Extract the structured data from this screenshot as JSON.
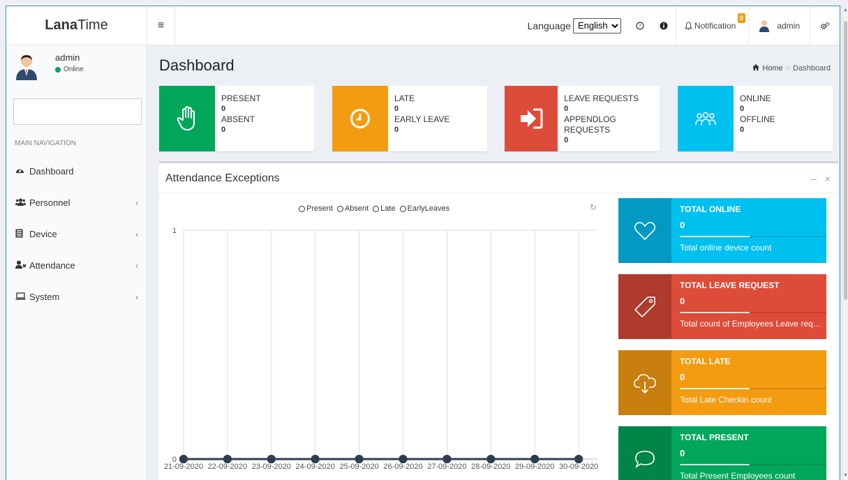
{
  "brand": {
    "bold": "Lana",
    "light": "Time"
  },
  "topbar": {
    "language_label": "Language",
    "language_value": "English",
    "notification_label": "Notification",
    "notification_count": "0",
    "user_name": "admin"
  },
  "sidebar": {
    "user_name": "admin",
    "user_status": "Online",
    "nav_header": "MAIN NAVIGATION",
    "items": [
      {
        "label": "Dashboard",
        "icon": "dashboard-icon"
      },
      {
        "label": "Personnel",
        "icon": "users-icon"
      },
      {
        "label": "Device",
        "icon": "device-icon"
      },
      {
        "label": "Attendance",
        "icon": "attendance-icon"
      },
      {
        "label": "System",
        "icon": "laptop-icon"
      }
    ]
  },
  "page": {
    "title": "Dashboard",
    "breadcrumb": {
      "home": "Home",
      "current": "Dashboard"
    }
  },
  "info_boxes": [
    {
      "color": "#00a65a",
      "icon": "hand-icon",
      "l1": "PRESENT",
      "v1": "0",
      "l2": "ABSENT",
      "v2": "0"
    },
    {
      "color": "#f39c12",
      "icon": "clock-icon",
      "l1": "LATE",
      "v1": "0",
      "l2": "EARLY LEAVE",
      "v2": "0"
    },
    {
      "color": "#dd4b39",
      "icon": "sign-in-icon",
      "l1": "LEAVE REQUESTS",
      "v1": "0",
      "l2": "APPENDLOG REQUESTS",
      "v2": "0"
    },
    {
      "color": "#00c0ef",
      "icon": "group-icon",
      "l1": "ONLINE",
      "v1": "0",
      "l2": "OFFLINE",
      "v2": "0"
    }
  ],
  "panel": {
    "title": "Attendance Exceptions"
  },
  "chart_data": {
    "type": "line",
    "x": [
      "21-09-2020",
      "22-09-2020",
      "23-09-2020",
      "24-09-2020",
      "25-09-2020",
      "26-09-2020",
      "27-09-2020",
      "28-09-2020",
      "29-09-2020",
      "30-09-2020"
    ],
    "series": [
      {
        "name": "Present",
        "values": [
          0,
          0,
          0,
          0,
          0,
          0,
          0,
          0,
          0,
          0
        ]
      },
      {
        "name": "Absent",
        "values": [
          0,
          0,
          0,
          0,
          0,
          0,
          0,
          0,
          0,
          0
        ]
      },
      {
        "name": "Late",
        "values": [
          0,
          0,
          0,
          0,
          0,
          0,
          0,
          0,
          0,
          0
        ]
      },
      {
        "name": "EarlyLeaves",
        "values": [
          0,
          0,
          0,
          0,
          0,
          0,
          0,
          0,
          0,
          0
        ]
      }
    ],
    "y_ticks": [
      "0",
      "1"
    ],
    "ylim": [
      0,
      1
    ],
    "grid": true,
    "legend": "top"
  },
  "stat_boxes": [
    {
      "title": "TOTAL ONLINE",
      "value": "0",
      "desc": "Total online device count",
      "color": "#00c0ef",
      "dark": "#0399c3",
      "icon": "heart-icon"
    },
    {
      "title": "TOTAL LEAVE REQUEST",
      "value": "0",
      "desc": "Total count of Employees Leave requests",
      "color": "#dd4b39",
      "dark": "#b03a2c",
      "icon": "tag-icon"
    },
    {
      "title": "TOTAL LATE",
      "value": "0",
      "desc": "Total Late Checkin count",
      "color": "#f39c12",
      "dark": "#c87f0d",
      "icon": "cloud-download-icon"
    },
    {
      "title": "TOTAL PRESENT",
      "value": "0",
      "desc": "Total Present Employees count",
      "color": "#00a65a",
      "dark": "#008548",
      "icon": "comment-icon"
    }
  ]
}
